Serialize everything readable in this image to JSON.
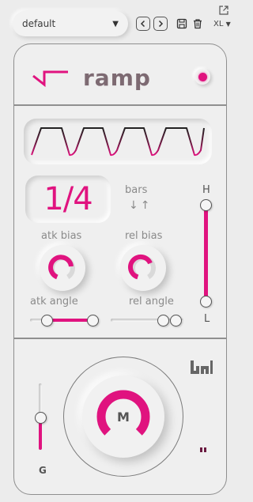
{
  "topbar": {
    "preset_value": "default",
    "size_value": "XL"
  },
  "module": {
    "title": "ramp",
    "enabled": true,
    "rate_value": "1/4",
    "rate_unit": "bars",
    "rate_unit_arrows": "↓↑",
    "atk_bias_label": "atk bias",
    "rel_bias_label": "rel bias",
    "atk_angle_label": "atk angle",
    "rel_angle_label": "rel angle",
    "range_high_label": "H",
    "range_low_label": "L",
    "mix_label": "M",
    "gain_label": "G"
  },
  "colors": {
    "accent": "#e0137f",
    "panel_bg": "#efefef",
    "text_muted": "#8a8a8a",
    "title": "#7d6a72"
  }
}
